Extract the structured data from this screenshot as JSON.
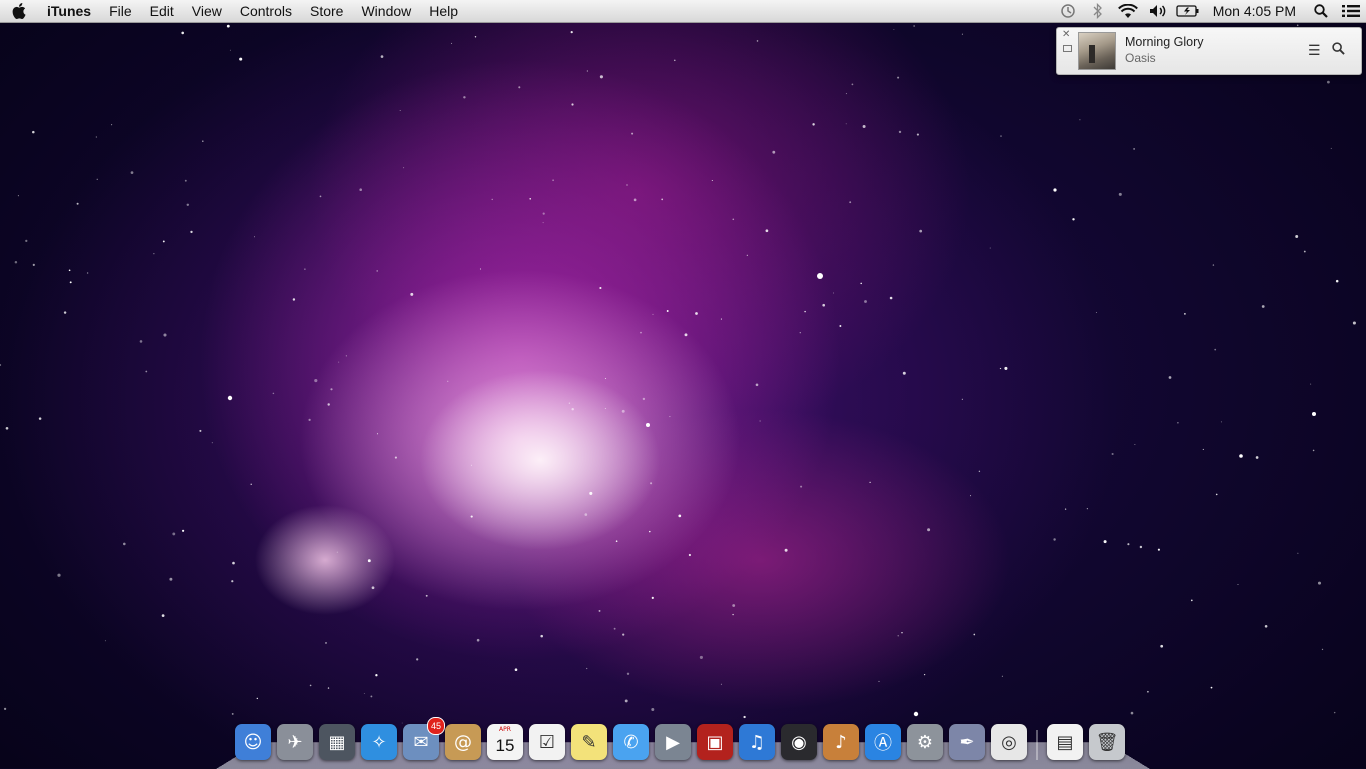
{
  "menubar": {
    "apple_icon": "apple-logo",
    "app_name": "iTunes",
    "menus": [
      "File",
      "Edit",
      "View",
      "Controls",
      "Store",
      "Window",
      "Help"
    ],
    "status_icons": [
      "time-machine-icon",
      "bluetooth-icon",
      "wifi-icon",
      "volume-icon",
      "battery-icon"
    ],
    "clock": "Mon 4:05 PM",
    "right_icons": [
      "spotlight-icon",
      "notification-center-icon"
    ]
  },
  "notification": {
    "song_title": "Morning Glory",
    "artist": "Oasis",
    "close_symbol": "✕",
    "list_symbol": "☰"
  },
  "dock": {
    "apps": [
      {
        "name": "Finder",
        "icon": "finder-icon",
        "bg": "#3f7fd8"
      },
      {
        "name": "Launchpad",
        "icon": "launchpad-icon",
        "bg": "#8a8f99"
      },
      {
        "name": "Mission Control",
        "icon": "mission-control-icon",
        "bg": "#4d5560"
      },
      {
        "name": "Safari",
        "icon": "safari-icon",
        "bg": "#2f8fe0"
      },
      {
        "name": "Mail",
        "icon": "mail-icon",
        "bg": "#6d8fbf",
        "badge": "45"
      },
      {
        "name": "Contacts",
        "icon": "contacts-icon",
        "bg": "#c79a55"
      },
      {
        "name": "Calendar",
        "icon": "calendar-icon",
        "bg": "#f4f4f4",
        "month": "APR",
        "day": "15"
      },
      {
        "name": "Reminders",
        "icon": "reminders-icon",
        "bg": "#f2f2f2"
      },
      {
        "name": "Notes",
        "icon": "notes-icon",
        "bg": "#f3e27a"
      },
      {
        "name": "Messages",
        "icon": "messages-icon",
        "bg": "#4aa3f0"
      },
      {
        "name": "FaceTime",
        "icon": "facetime-icon",
        "bg": "#7b8592"
      },
      {
        "name": "Photo Booth",
        "icon": "photo-booth-icon",
        "bg": "#b3221d"
      },
      {
        "name": "iTunes",
        "icon": "itunes-icon",
        "bg": "#2e79d6"
      },
      {
        "name": "Aperture",
        "icon": "aperture-icon",
        "bg": "#2a2a2e"
      },
      {
        "name": "GarageBand",
        "icon": "garageband-icon",
        "bg": "#c8803a"
      },
      {
        "name": "App Store",
        "icon": "app-store-icon",
        "bg": "#2a84e2"
      },
      {
        "name": "System Preferences",
        "icon": "system-preferences-icon",
        "bg": "#8d939b"
      },
      {
        "name": "Script Editor",
        "icon": "script-editor-icon",
        "bg": "#7d86a8"
      },
      {
        "name": "Google Chrome",
        "icon": "chrome-icon",
        "bg": "#e7e7e7"
      }
    ],
    "trailing": [
      {
        "name": "Documents",
        "icon": "documents-stack-icon",
        "bg": "#f2f2f2"
      },
      {
        "name": "Trash",
        "icon": "trash-icon",
        "bg": "#c6c9cd"
      }
    ]
  }
}
